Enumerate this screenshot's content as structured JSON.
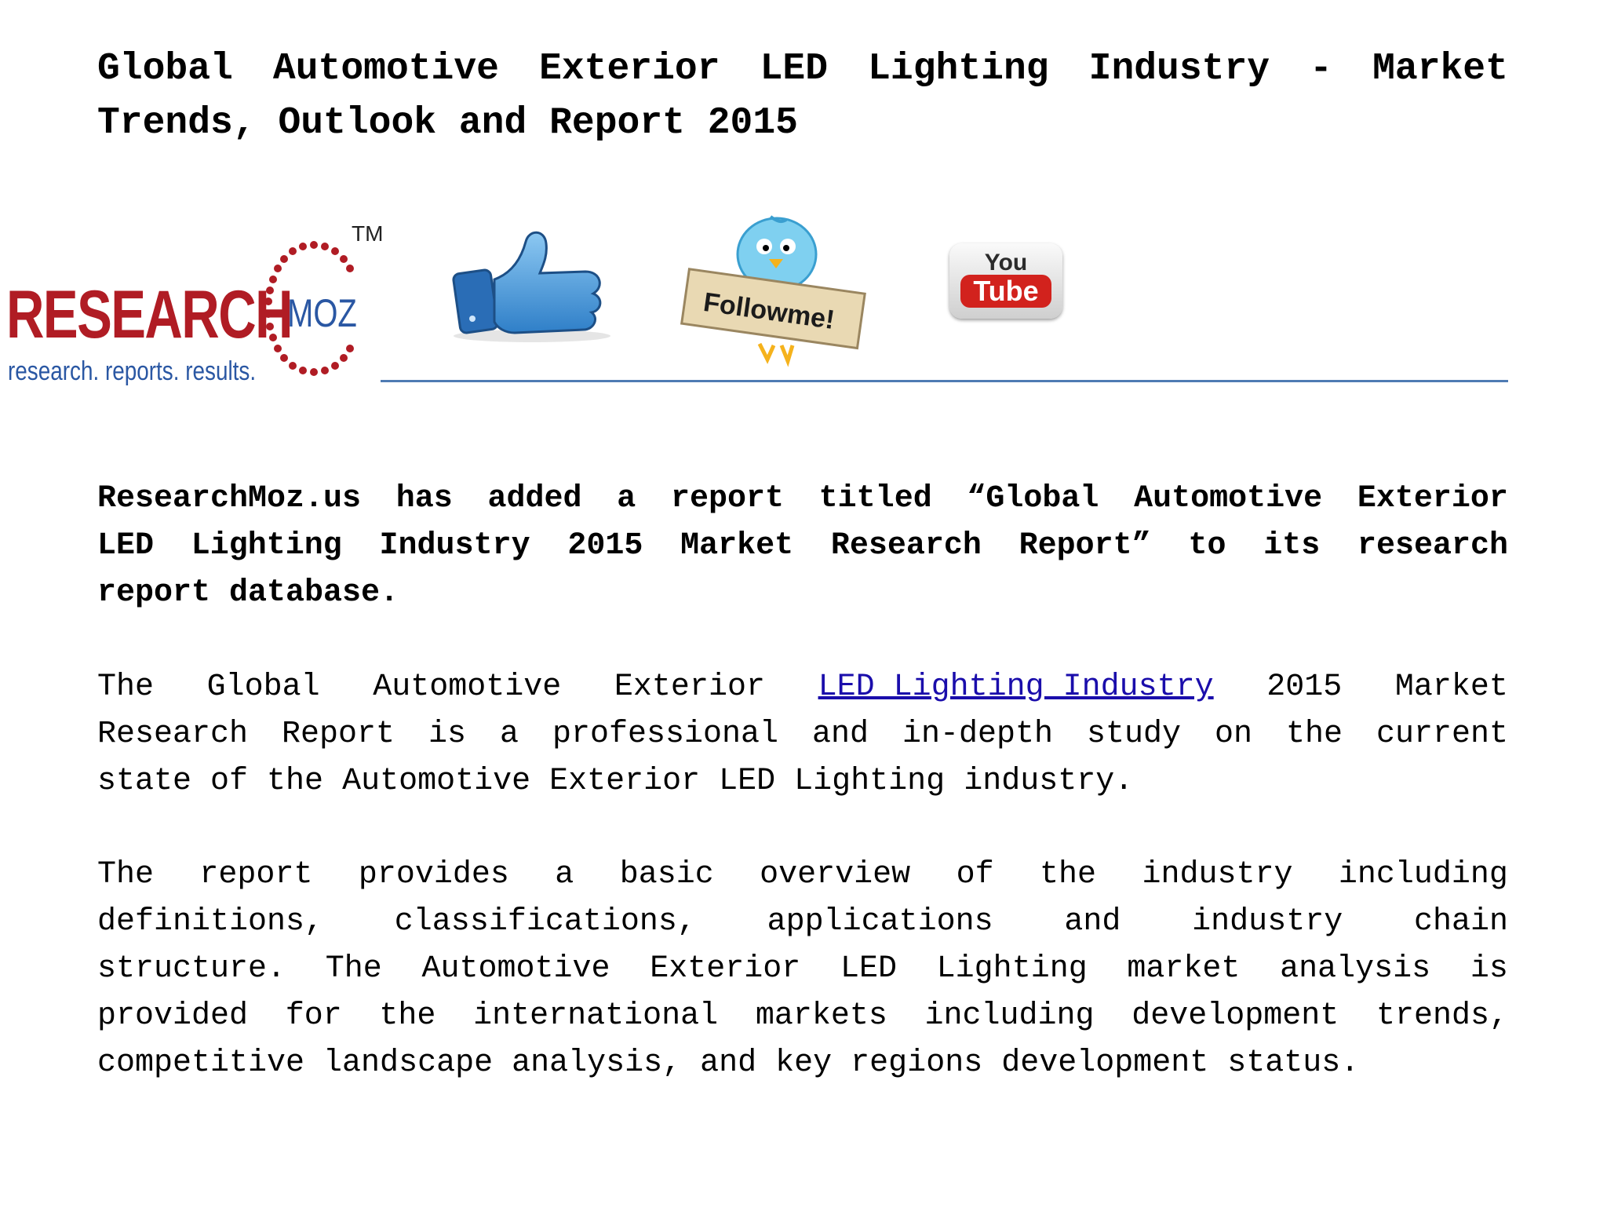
{
  "title": {
    "lines": [
      [
        "Global",
        "Automotive",
        "Exterior",
        "LED",
        "Lighting",
        "Industry",
        "-",
        "Market"
      ],
      [
        "Trends,",
        "Outlook",
        "and",
        "Report",
        "2015"
      ]
    ]
  },
  "logo": {
    "name": "RESEARCH",
    "moz": "MOZ",
    "tm": "TM",
    "tagline": "research. reports. results."
  },
  "social": {
    "like_icon": "thumbs-up-icon",
    "follow_label": "Followme!",
    "youtube_you": "You",
    "youtube_tube": "Tube"
  },
  "paragraph1": {
    "lines": [
      [
        "ResearchMoz.us",
        "has",
        "added",
        "a",
        "report",
        "titled",
        "“Global",
        "Automotive",
        "Exterior"
      ],
      [
        "LED",
        "Lighting",
        "Industry",
        "2015",
        "Market",
        "Research",
        "Report”",
        "to",
        "its",
        "research"
      ],
      [
        "report",
        "database."
      ]
    ]
  },
  "paragraph2": {
    "line1_before": [
      "The",
      "Global",
      "Automotive",
      "Exterior"
    ],
    "link_text": "LED Lighting Industry",
    "line1_after": [
      "2015",
      "Market"
    ],
    "lines": [
      [
        "Research",
        "Report",
        "is",
        "a",
        "professional",
        "and",
        "in-depth",
        "study",
        "on",
        "the",
        "current"
      ],
      [
        "state",
        "of",
        "the",
        "Automotive",
        "Exterior",
        "LED",
        "Lighting",
        "industry."
      ]
    ]
  },
  "paragraph3": {
    "lines": [
      [
        "The",
        "report",
        "provides",
        "a",
        "basic",
        "overview",
        "of",
        "the",
        "industry",
        "including"
      ],
      [
        "definitions,",
        "classifications,",
        "applications",
        "and",
        "industry",
        "chain"
      ],
      [
        "structure.",
        "The",
        "Automotive",
        "Exterior",
        "LED",
        "Lighting",
        "market",
        "analysis",
        "is"
      ],
      [
        "provided",
        "for",
        "the",
        "international",
        "markets",
        "including",
        "development",
        "trends,"
      ],
      [
        "competitive",
        "landscape",
        "analysis,",
        "and",
        "key",
        "regions",
        "development",
        "status."
      ]
    ]
  },
  "colors": {
    "logo_red": "#b01c24",
    "logo_blue": "#2a57a3",
    "rule_blue": "#4f7bb3",
    "link_blue": "#1a0dab",
    "youtube_red": "#d2221d"
  }
}
